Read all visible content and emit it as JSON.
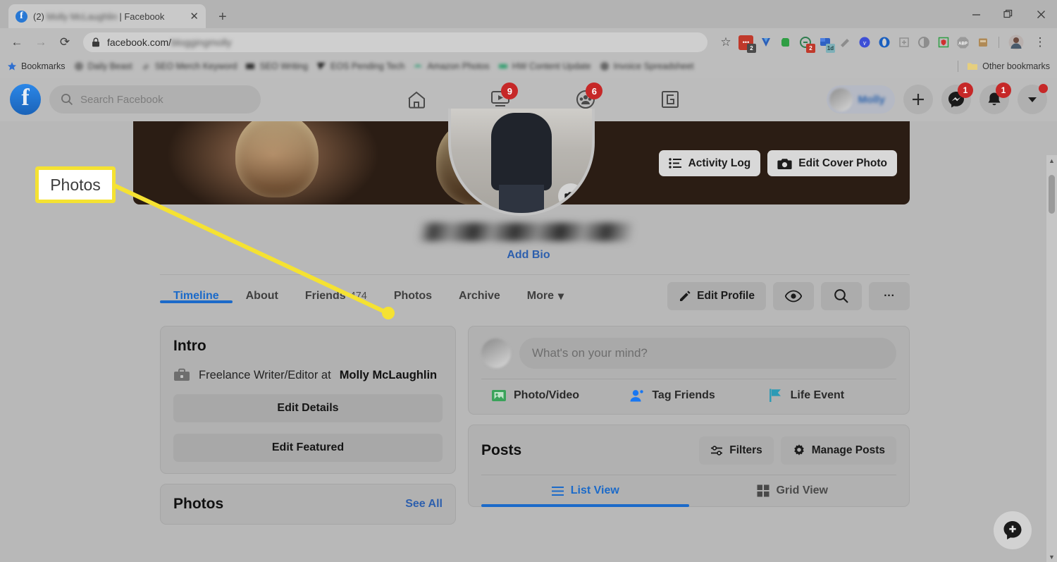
{
  "browser": {
    "tab": {
      "unread_count": "(2)",
      "blurred_name": "Molly McLaughlin",
      "suffix": "| Facebook",
      "close": "✕"
    },
    "new_tab": "+",
    "window": {
      "minimize": "—",
      "restore": "❐",
      "close": "✕"
    },
    "nav": {
      "back": "←",
      "forward": "→",
      "reload": "⟳"
    },
    "omnibox": {
      "lock": "🔒",
      "url_visible": "facebook.com/",
      "url_blurred": "bloggingmolly",
      "star": "☆"
    },
    "extensions": [
      {
        "name": "red-notes-extension",
        "glyph": "▤",
        "badge": "2",
        "badge_style": "gray",
        "color": "#c0392b"
      },
      {
        "name": "v-extension",
        "glyph": "V",
        "badge": "",
        "color": "#2b5fb8"
      },
      {
        "name": "evernote-extension",
        "glyph": "◆",
        "badge": "",
        "color": "#2f9e44"
      },
      {
        "name": "lastpass-extension",
        "glyph": "●",
        "badge": "2",
        "badge_style": "red",
        "color": "#2f7d4f"
      },
      {
        "name": "pocket-extension",
        "glyph": "■",
        "badge": "1d",
        "badge_style": "teal",
        "color": "#2f62c4"
      },
      {
        "name": "pen-extension",
        "glyph": "✎",
        "badge": "",
        "color": "#8a8a8a"
      },
      {
        "name": "vimeo-extension",
        "glyph": "v",
        "badge": "",
        "color": "#3d4fd6"
      },
      {
        "name": "opera-extension",
        "glyph": "O",
        "badge": "",
        "color": "#1a5fbf"
      },
      {
        "name": "print-extension",
        "glyph": "⎙",
        "badge": "",
        "color": "#8d8d8d"
      },
      {
        "name": "circle-extension",
        "glyph": "●",
        "badge": "",
        "color": "#9b9b9b"
      },
      {
        "name": "shield-extension",
        "glyph": "□",
        "badge": "",
        "color": "#cf3030"
      },
      {
        "name": "adblock-plus-extension",
        "glyph": "ABP",
        "badge": "",
        "color": "#9a9a9a"
      },
      {
        "name": "clipboard-extension",
        "glyph": "▤",
        "badge": "",
        "color": "#b08a56"
      }
    ],
    "profile_avatar": "avatar",
    "menu": "⋮",
    "bookmarks_bar": {
      "star_label": "Bookmarks",
      "items": [
        {
          "label": "Daily Beast",
          "blurred": true
        },
        {
          "label": "SEO Merch Keyword",
          "blurred": true
        },
        {
          "label": "SEO Writing",
          "blurred": true
        },
        {
          "label": "EOS Pending Tech",
          "blurred": true
        },
        {
          "label": "Amazon Photos",
          "blurred": true
        },
        {
          "label": "HW Content Update",
          "blurred": true
        },
        {
          "label": "Invoice Spreadsheet",
          "blurred": true
        }
      ],
      "other_bookmarks": "Other bookmarks"
    }
  },
  "facebook": {
    "header": {
      "logo": "f",
      "search_placeholder": "Search Facebook",
      "nav_items": [
        {
          "name": "home-icon",
          "badge": ""
        },
        {
          "name": "watch-icon",
          "badge": "9"
        },
        {
          "name": "groups-icon",
          "badge": "6"
        },
        {
          "name": "gaming-icon",
          "badge": ""
        }
      ],
      "profile_name": "Molly",
      "create_label": "+",
      "messenger_badge": "1",
      "notifications_badge": "1",
      "account_has_dot": true
    },
    "cover": {
      "activity_log": "Activity Log",
      "edit_cover_photo": "Edit Cover Photo",
      "camera_button": "camera"
    },
    "profile": {
      "name_blurred": true,
      "add_bio": "Add Bio"
    },
    "tabs": [
      {
        "label": "Timeline",
        "count": "",
        "active": true
      },
      {
        "label": "About",
        "count": "",
        "active": false
      },
      {
        "label": "Friends",
        "count": "474",
        "active": false
      },
      {
        "label": "Photos",
        "count": "",
        "active": false
      },
      {
        "label": "Archive",
        "count": "",
        "active": false
      },
      {
        "label": "More",
        "count": "",
        "active": false,
        "caret": "▾"
      }
    ],
    "tab_actions": {
      "edit_profile": "Edit Profile",
      "view_as": "eye",
      "search": "search",
      "more": "···"
    },
    "intro": {
      "title": "Intro",
      "work_prefix": "Freelance Writer/Editor at",
      "work_employer": "Molly McLaughlin",
      "edit_details": "Edit Details",
      "edit_featured": "Edit Featured"
    },
    "photos_card": {
      "title": "Photos",
      "see_all": "See All"
    },
    "composer": {
      "placeholder": "What's on your mind?",
      "actions": [
        {
          "label": "Photo/Video",
          "icon": "photo-video-icon",
          "color": "#3aa35a"
        },
        {
          "label": "Tag Friends",
          "icon": "tag-friends-icon",
          "color": "#1877f2"
        },
        {
          "label": "Life Event",
          "icon": "life-event-icon",
          "color": "#2b9ab5"
        }
      ]
    },
    "posts": {
      "title": "Posts",
      "filters": "Filters",
      "manage_posts": "Manage Posts",
      "views": [
        {
          "label": "List View",
          "icon": "list-view-icon",
          "active": true
        },
        {
          "label": "Grid View",
          "icon": "grid-view-icon",
          "active": false
        }
      ]
    },
    "fab": {
      "name": "new-message-button"
    },
    "scrollbar": {
      "up": "▲",
      "down": "▼"
    }
  },
  "annotation": {
    "callout_label": "Photos",
    "highlight_color": "#f5e232",
    "points_to": "photos-tab"
  }
}
